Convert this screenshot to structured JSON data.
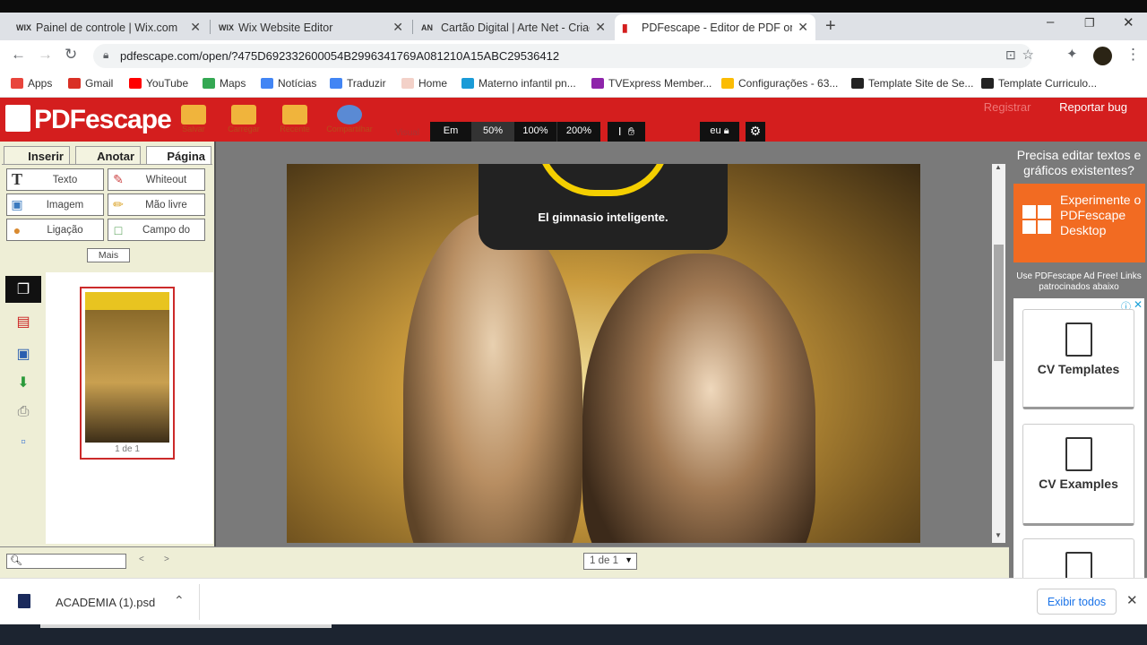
{
  "browser": {
    "tabs": [
      {
        "favicon": "WIX",
        "title": "Painel de controle | Wix.com"
      },
      {
        "favicon": "WIX",
        "title": "Wix Website Editor"
      },
      {
        "favicon": "AN",
        "title": "Cartão Digital | Arte Net - Criação"
      },
      {
        "favicon": "pdf",
        "title": "PDFescape - Editor de PDF online"
      }
    ],
    "new_tab": "+",
    "url": "pdfescape.com/open/?475D692332600054B2996341769A081210A15ABC29536412",
    "bookmarks": [
      {
        "label": "Apps",
        "color": "#e8453c"
      },
      {
        "label": "Gmail",
        "color": "#d93025"
      },
      {
        "label": "YouTube",
        "color": "#ff0000"
      },
      {
        "label": "Maps",
        "color": "#34a853"
      },
      {
        "label": "Notícias",
        "color": "#4285f4"
      },
      {
        "label": "Traduzir",
        "color": "#4285f4"
      },
      {
        "label": "Home",
        "color": "#f3d1c8"
      },
      {
        "label": "Materno infantil pn...",
        "color": "#1a9bd7"
      },
      {
        "label": "TVExpress Member...",
        "color": "#8e24aa"
      },
      {
        "label": "Configurações - 63...",
        "color": "#fbbc04"
      },
      {
        "label": "Template Site de Se...",
        "color": "#222"
      },
      {
        "label": "Template Curriculo...",
        "color": "#222"
      }
    ]
  },
  "app": {
    "logo_text": "PDFescape",
    "tools": [
      "Salvar",
      "Carregar",
      "Recente",
      "Compartilhar"
    ],
    "view_label": "Visual",
    "zoom_options": [
      "Em",
      "50%",
      "100%",
      "200%"
    ],
    "user_label": "eu",
    "header_faint": "Registrar",
    "report_bug": "Reportar bug",
    "panel_tabs": [
      "Inserir",
      "Anotar",
      "Página"
    ],
    "tool_buttons": [
      {
        "label": "Texto",
        "icon": "T"
      },
      {
        "label": "Whiteout",
        "icon": "✎"
      },
      {
        "label": "Imagem",
        "icon": "▣"
      },
      {
        "label": "Mão livre",
        "icon": "✏"
      },
      {
        "label": "Ligação",
        "icon": "●"
      },
      {
        "label": "Campo do",
        "icon": "□"
      }
    ],
    "more_button": "Mais",
    "thumbnail_label": "1 de 1",
    "document_tagline": "El gimnasio inteligente.",
    "page_select": "1 de 1",
    "nav_prev": "<",
    "nav_next": ">"
  },
  "ad": {
    "title": "Precisa editar textos e gráficos existentes?",
    "promo": "Experimente o PDFescape Desktop",
    "note": "Use PDFescape Ad Free! Links patrocinados abaixo",
    "cards": [
      "CV Templates",
      "CV Examples"
    ]
  },
  "downloads": {
    "file_name": "ACADEMIA (1).psd",
    "show_all": "Exibir todos"
  },
  "colors": {
    "brand_red": "#d41e1e",
    "promo_orange": "#f26b22",
    "accent_yellow": "#f4cf00"
  }
}
